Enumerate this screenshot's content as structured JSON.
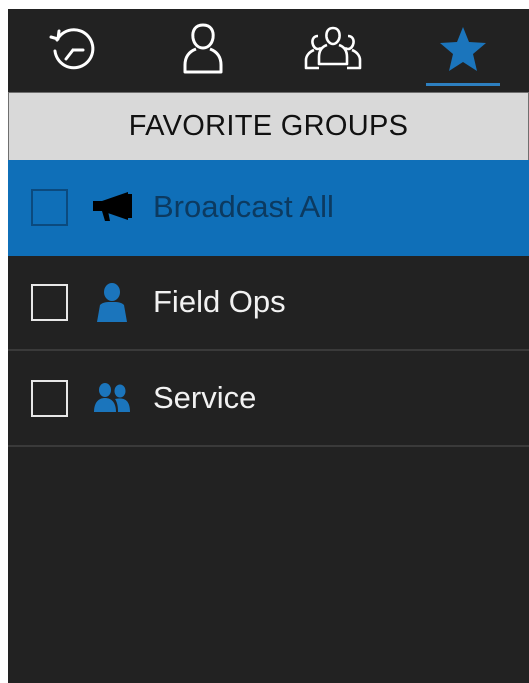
{
  "tabs": [
    {
      "name": "history",
      "icon": "history-icon",
      "active": false
    },
    {
      "name": "contacts",
      "icon": "person-icon",
      "active": false
    },
    {
      "name": "groups",
      "icon": "group-icon",
      "active": false
    },
    {
      "name": "favorites",
      "icon": "star-icon",
      "active": true
    }
  ],
  "header": {
    "title": "FAVORITE GROUPS"
  },
  "groups": [
    {
      "label": "Broadcast All",
      "icon": "megaphone-icon",
      "checked": false,
      "selected": true
    },
    {
      "label": "Field Ops",
      "icon": "person-icon",
      "checked": false,
      "selected": false
    },
    {
      "label": "Service",
      "icon": "two-people-icon",
      "checked": false,
      "selected": false
    }
  ],
  "colors": {
    "accent": "#0f6fb8",
    "background": "#222222",
    "header_bg": "#d9d9d9",
    "icon_blue": "#1b75bc"
  }
}
